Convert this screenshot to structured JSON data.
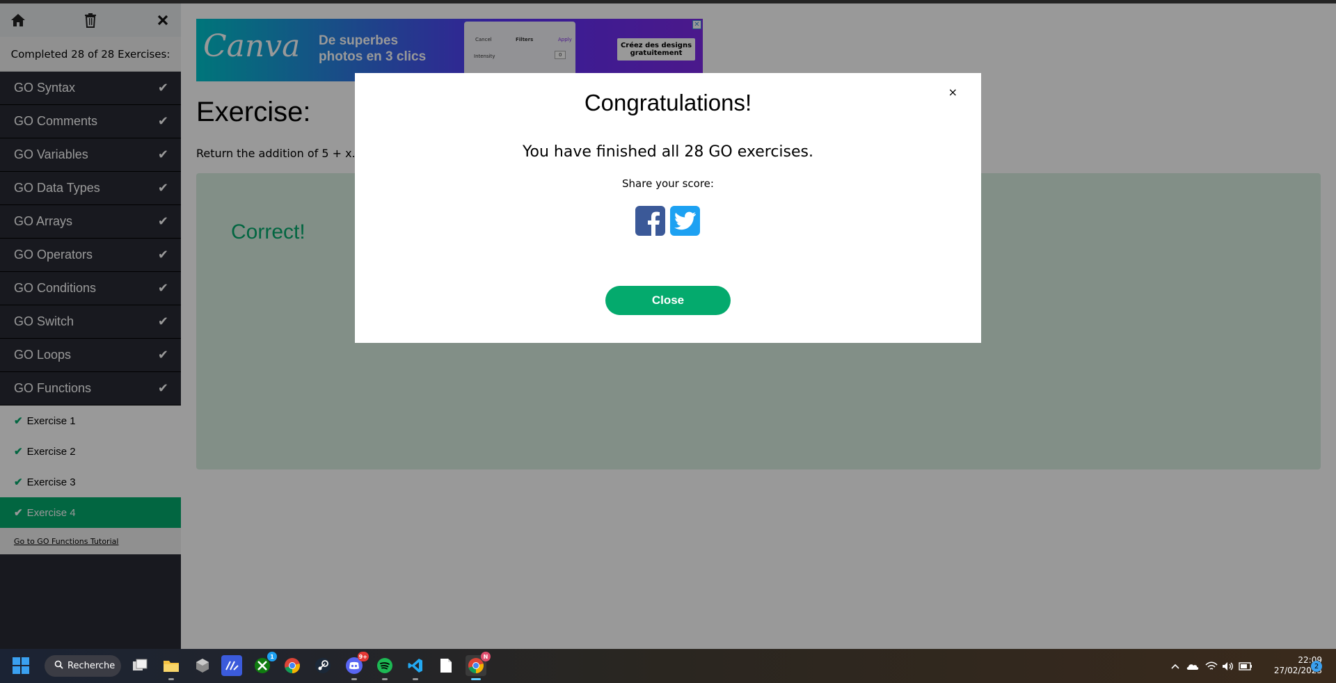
{
  "sidebar": {
    "completed_text": "Completed 28 of 28 Exercises:",
    "items": [
      {
        "label": "GO Syntax"
      },
      {
        "label": "GO Comments"
      },
      {
        "label": "GO Variables"
      },
      {
        "label": "GO Data Types"
      },
      {
        "label": "GO Arrays"
      },
      {
        "label": "GO Operators"
      },
      {
        "label": "GO Conditions"
      },
      {
        "label": "GO Switch"
      },
      {
        "label": "GO Loops"
      },
      {
        "label": "GO Functions"
      }
    ],
    "sub_items": [
      {
        "label": "Exercise 1"
      },
      {
        "label": "Exercise 2"
      },
      {
        "label": "Exercise 3"
      },
      {
        "label": "Exercise 4"
      }
    ],
    "tutorial_link": "Go to GO Functions Tutorial"
  },
  "ad": {
    "logo": "Canva",
    "headline": "De superbes photos en 3 clics",
    "panel_cancel": "Cancel",
    "panel_filters": "Filters",
    "panel_apply": "Apply",
    "panel_intensity": "Intensity",
    "panel_value": "0",
    "cta": "Créez des designs gratuitement",
    "close": "✕"
  },
  "main": {
    "title": "Exercise:",
    "description": "Return the addition of 5 + x.",
    "result": "Correct!"
  },
  "modal": {
    "close_x": "×",
    "title": "Congratulations!",
    "message": "You have finished all 28 GO exercises.",
    "share_label": "Share your score:",
    "close_button": "Close"
  },
  "taskbar": {
    "search_label": "Recherche",
    "xbox_badge": "1",
    "discord_badge": "9+",
    "chrome_badge": "N",
    "time": "22:09",
    "date": "27/02/2023",
    "notifications": "2"
  },
  "colors": {
    "accent": "#04aa6d",
    "sidebar_bg": "#282a35",
    "correct_bg": "#d9eee1",
    "facebook": "#3b5998",
    "twitter": "#1da1f2"
  }
}
